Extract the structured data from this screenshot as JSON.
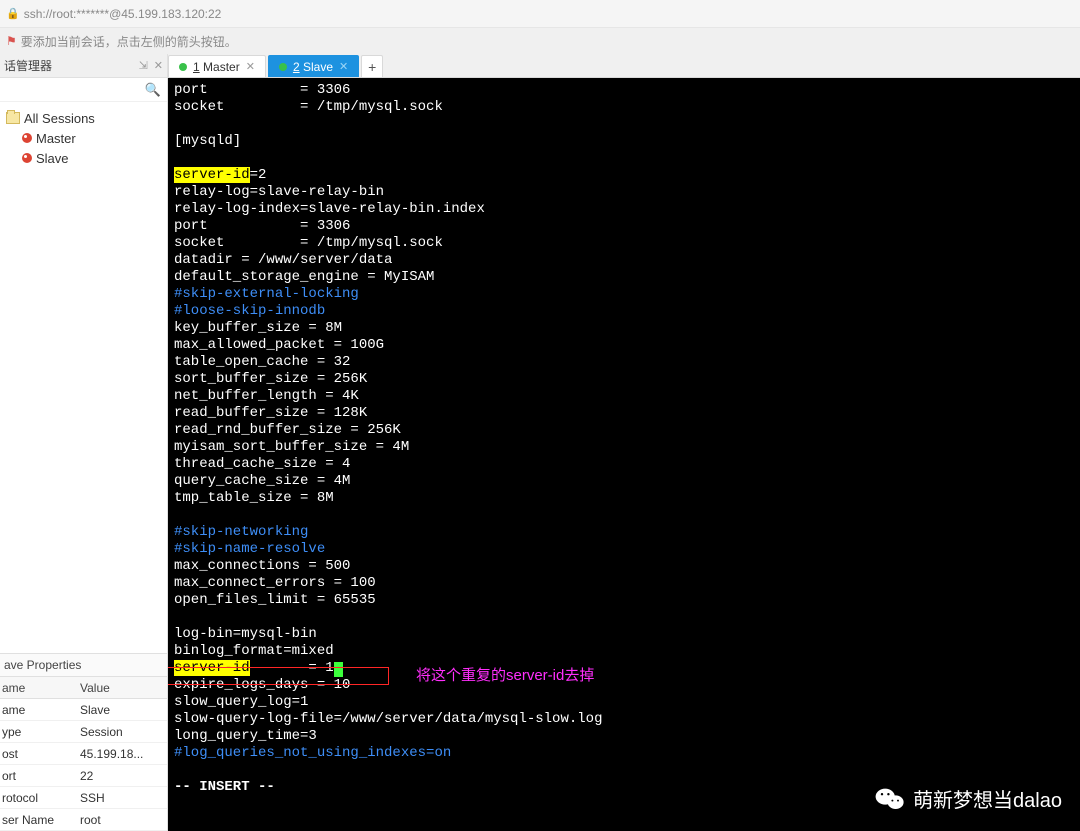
{
  "title": "ssh://root:*******@45.199.183.120:22",
  "hint": "要添加当前会话，点击左侧的箭头按钮。",
  "session_manager": {
    "title": "话管理器",
    "root": "All Sessions",
    "items": [
      "Master",
      "Slave"
    ]
  },
  "tabs": {
    "master": {
      "num": "1",
      "label": "Master"
    },
    "slave": {
      "num": "2",
      "label": "Slave"
    }
  },
  "props": {
    "title": "ave Properties",
    "head": {
      "name": "ame",
      "value": "Value"
    },
    "rows": [
      {
        "k": "ame",
        "v": "Slave"
      },
      {
        "k": "ype",
        "v": "Session"
      },
      {
        "k": "ost",
        "v": "45.199.18..."
      },
      {
        "k": "ort",
        "v": "22"
      },
      {
        "k": "rotocol",
        "v": "SSH"
      },
      {
        "k": "ser Name",
        "v": "root"
      }
    ]
  },
  "terminal": {
    "line1a": "port           = 3306",
    "line2": "socket         = /tmp/mysql.sock",
    "line4": "[mysqld]",
    "line6_hl": "server-id",
    "line6_rest": "=2",
    "line7": "relay-log=slave-relay-bin",
    "line8": "relay-log-index=slave-relay-bin.index",
    "line9": "port           = 3306",
    "line10": "socket         = /tmp/mysql.sock",
    "line11": "datadir = /www/server/data",
    "line12": "default_storage_engine = MyISAM",
    "line13": "#skip-external-locking",
    "line14": "#loose-skip-innodb",
    "line15": "key_buffer_size = 8M",
    "line16": "max_allowed_packet = 100G",
    "line17": "table_open_cache = 32",
    "line18": "sort_buffer_size = 256K",
    "line19": "net_buffer_length = 4K",
    "line20": "read_buffer_size = 128K",
    "line21": "read_rnd_buffer_size = 256K",
    "line22": "myisam_sort_buffer_size = 4M",
    "line23": "thread_cache_size = 4",
    "line24": "query_cache_size = 4M",
    "line25": "tmp_table_size = 8M",
    "line27": "#skip-networking",
    "line28": "#skip-name-resolve",
    "line29": "max_connections = 500",
    "line30": "max_connect_errors = 100",
    "line31": "open_files_limit = 65535",
    "line33": "log-bin=mysql-bin",
    "line34": "binlog_format=mixed",
    "line35_hl": "server-id",
    "line35_rest": "       = 1",
    "line36": "expire_logs_days = 10",
    "line37": "slow_query_log=1",
    "line38": "slow-query-log-file=/www/server/data/mysql-slow.log",
    "line39": "long_query_time=3",
    "line40": "#log_queries_not_using_indexes=on",
    "insert": "-- INSERT --"
  },
  "annotation": "将这个重复的server-id去掉",
  "watermark": "萌新梦想当dalao"
}
